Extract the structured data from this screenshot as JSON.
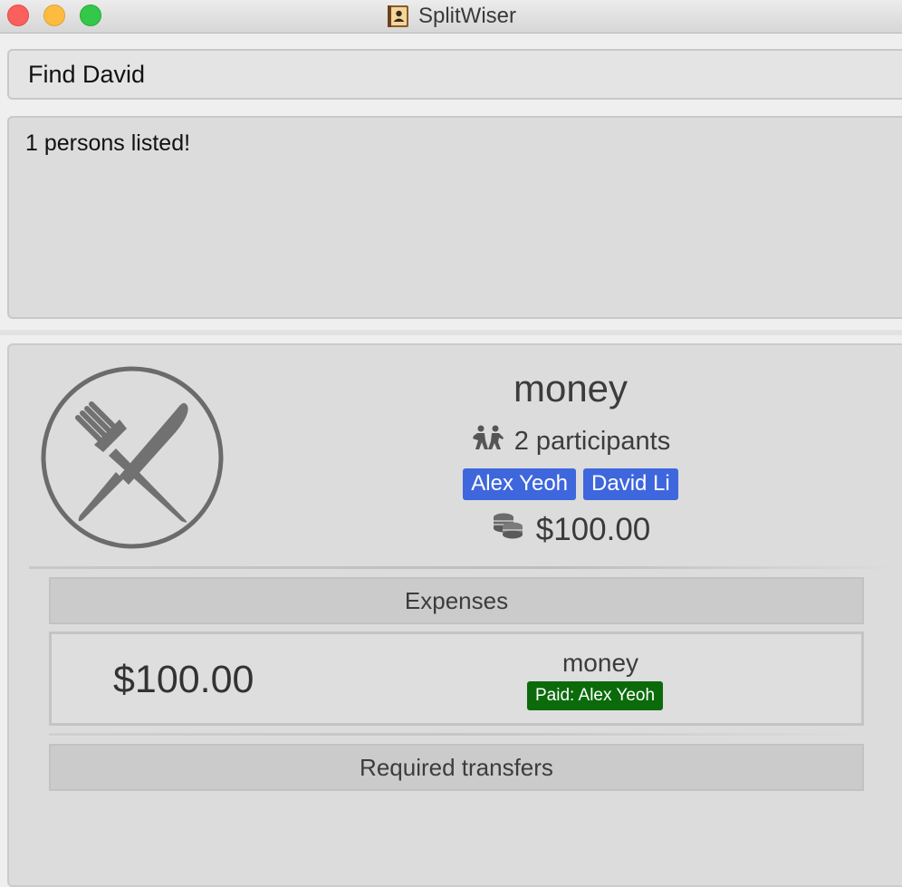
{
  "window": {
    "title": "SplitWiser",
    "icon": "address-book-icon"
  },
  "command_box": {
    "value": "Find David"
  },
  "result_box": {
    "text": "1 persons listed!"
  },
  "group": {
    "icon": "fork-knife-icon",
    "name": "money",
    "participants_icon": "people-icon",
    "participants_label": "2 participants",
    "participants": [
      "Alex Yeoh",
      "David Li"
    ],
    "amount_icon": "coins-icon",
    "amount": "$100.00"
  },
  "expenses": {
    "header": "Expenses",
    "items": [
      {
        "amount": "$100.00",
        "description": "money",
        "paid_by": "Paid: Alex Yeoh"
      }
    ]
  },
  "transfers": {
    "header": "Required transfers"
  },
  "colors": {
    "tag_blue": "#3e67dd",
    "paid_green": "#0b6b0b"
  }
}
